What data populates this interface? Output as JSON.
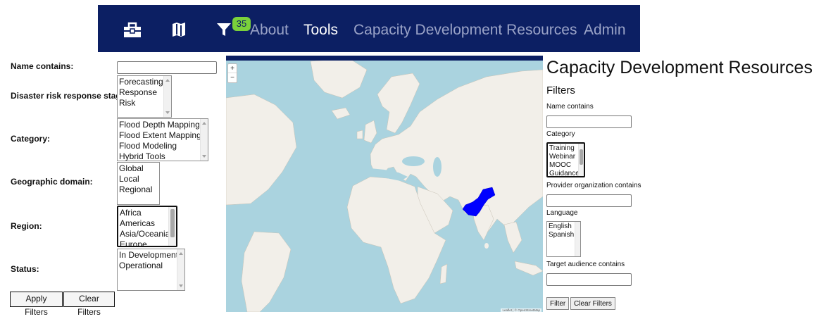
{
  "navbar": {
    "badge_count": "35",
    "icons": [
      "toolbox-icon",
      "map-icon",
      "filter-icon"
    ],
    "links": [
      {
        "label": "About",
        "active": false
      },
      {
        "label": "Tools",
        "active": true
      },
      {
        "label": "Capacity Development Resources",
        "active": false
      },
      {
        "label": "Admin",
        "active": false
      }
    ]
  },
  "left_form": {
    "name_label": "Name contains:",
    "name_value": "",
    "stage_label": "Disaster risk response stage:",
    "stage_options": [
      "Forecasting",
      "Response",
      "Risk"
    ],
    "category_label": "Category:",
    "category_options": [
      "Flood Depth Mapping",
      "Flood Extent Mapping",
      "Flood Modeling",
      "Hybrid Tools"
    ],
    "domain_label": "Geographic domain:",
    "domain_options": [
      "Global",
      "Local",
      "Regional"
    ],
    "region_label": "Region:",
    "region_options": [
      "Africa",
      "Americas",
      "Asia/Oceania",
      "Europe"
    ],
    "status_label": "Status:",
    "status_options": [
      "In Development",
      "Operational"
    ],
    "apply_button": "Apply Filters",
    "clear_button": "Clear Filters"
  },
  "map": {
    "zoom_in": "+",
    "zoom_out": "−",
    "attribution": "Leaflet | © OpenStreetMap",
    "highlight_color": "#0000ff",
    "water_color": "#aad3df",
    "land_color": "#f2efe9"
  },
  "right_panel": {
    "title": "Capacity Development Resources",
    "filters_heading": "Filters",
    "name_label": "Name contains",
    "category_label": "Category",
    "category_options": [
      "Training",
      "Webinar",
      "MOOC",
      "Guidance"
    ],
    "provider_label": "Provider organization contains",
    "language_label": "Language",
    "language_options": [
      "English",
      "Spanish"
    ],
    "audience_label": "Target audience contains",
    "filter_button": "Filter",
    "clear_button": "Clear Filters"
  },
  "colors": {
    "navbar_bg": "#0c1f63",
    "nav_link": "#9aa3c7",
    "nav_link_active": "#ffffff",
    "badge_bg": "#7ad13b"
  }
}
